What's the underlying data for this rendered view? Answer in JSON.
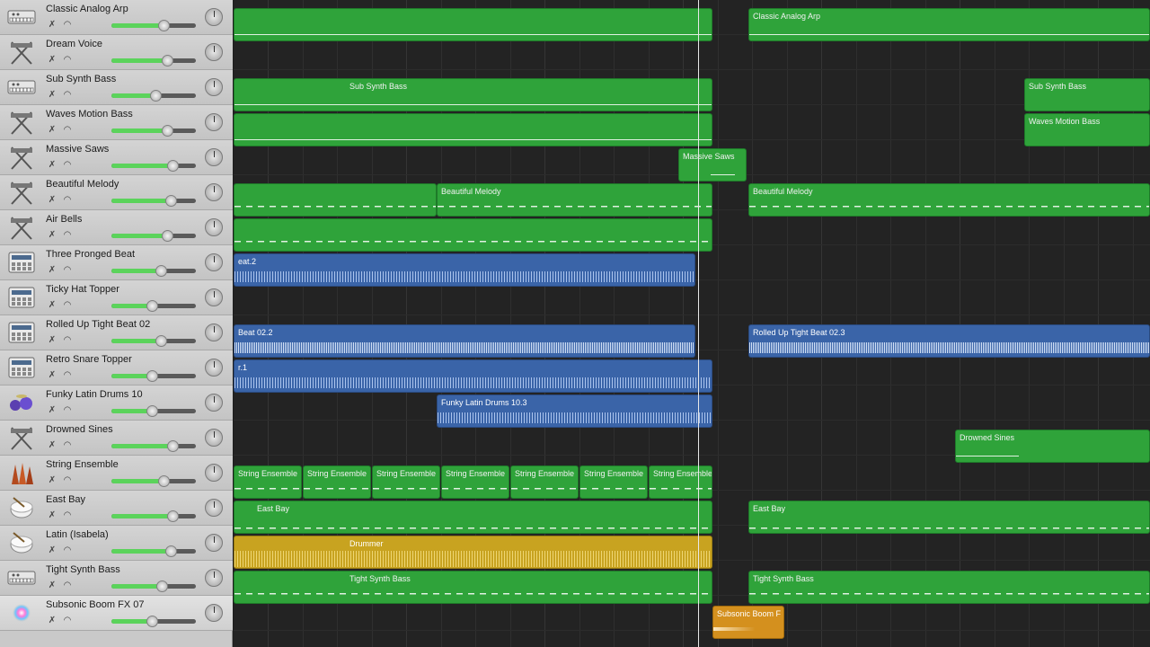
{
  "tracks": [
    {
      "name": "Classic Analog Arp",
      "icon": "synth-keyboard-icon",
      "volume": 0.62
    },
    {
      "name": "Dream Voice",
      "icon": "synth-stand-icon",
      "volume": 0.66
    },
    {
      "name": "Sub Synth Bass",
      "icon": "synth-keyboard-icon",
      "volume": 0.52
    },
    {
      "name": "Waves Motion Bass",
      "icon": "synth-stand-icon",
      "volume": 0.66
    },
    {
      "name": "Massive Saws",
      "icon": "synth-stand-icon",
      "volume": 0.72
    },
    {
      "name": "Beautiful Melody",
      "icon": "synth-stand-icon",
      "volume": 0.7
    },
    {
      "name": "Air Bells",
      "icon": "synth-stand-icon",
      "volume": 0.66
    },
    {
      "name": "Three Pronged Beat",
      "icon": "drum-machine-icon",
      "volume": 0.58
    },
    {
      "name": "Ticky Hat Topper",
      "icon": "drum-machine-icon",
      "volume": 0.48
    },
    {
      "name": "Rolled Up Tight Beat 02",
      "icon": "drum-machine-icon",
      "volume": 0.58
    },
    {
      "name": "Retro Snare Topper",
      "icon": "drum-machine-icon",
      "volume": 0.48
    },
    {
      "name": "Funky Latin Drums 10",
      "icon": "drum-kit-icon",
      "volume": 0.48
    },
    {
      "name": "Drowned Sines",
      "icon": "synth-stand-icon",
      "volume": 0.72
    },
    {
      "name": "String Ensemble",
      "icon": "strings-icon",
      "volume": 0.62
    },
    {
      "name": "East Bay",
      "icon": "drummer-icon",
      "volume": 0.72
    },
    {
      "name": "Latin (Isabela)",
      "icon": "drummer-icon",
      "volume": 0.7
    },
    {
      "name": "Tight Synth Bass",
      "icon": "synth-keyboard-icon",
      "volume": 0.6
    },
    {
      "name": "Subsonic Boom FX 07",
      "icon": "fx-burst-icon",
      "volume": 0.48
    }
  ],
  "regions": {
    "classic_analog_arp_2": "Classic Analog Arp",
    "sub_synth_bass_1": "Sub Synth Bass",
    "sub_synth_bass_2": "Sub Synth Bass",
    "waves_motion_bass_2": "Waves Motion Bass",
    "massive_saws": "Massive Saws",
    "beautiful_melody_1": "Beautiful Melody",
    "beautiful_melody_2": "Beautiful Melody",
    "three_pronged": "eat.2",
    "rolled_up_1": "Beat 02.2",
    "rolled_up_2": "Rolled Up Tight Beat 02.3",
    "retro_snare": "r.1",
    "funky_latin": "Funky Latin Drums 10.3",
    "drowned_sines": "Drowned Sines",
    "string_ensemble": "String Ensemble",
    "east_bay_1": "East Bay",
    "east_bay_2": "East Bay",
    "drummer": "Drummer",
    "tight_synth_bass_1": "Tight Synth Bass",
    "tight_synth_bass_2": "Tight Synth Bass",
    "subsonic_boom": "Subsonic Boom F"
  },
  "colors": {
    "midi_region": "#2fa33a",
    "audio_region": "#3a64a8",
    "drummer_region": "#c8a320",
    "fx_region": "#d4901e",
    "volume_fill": "#5bd35b"
  }
}
